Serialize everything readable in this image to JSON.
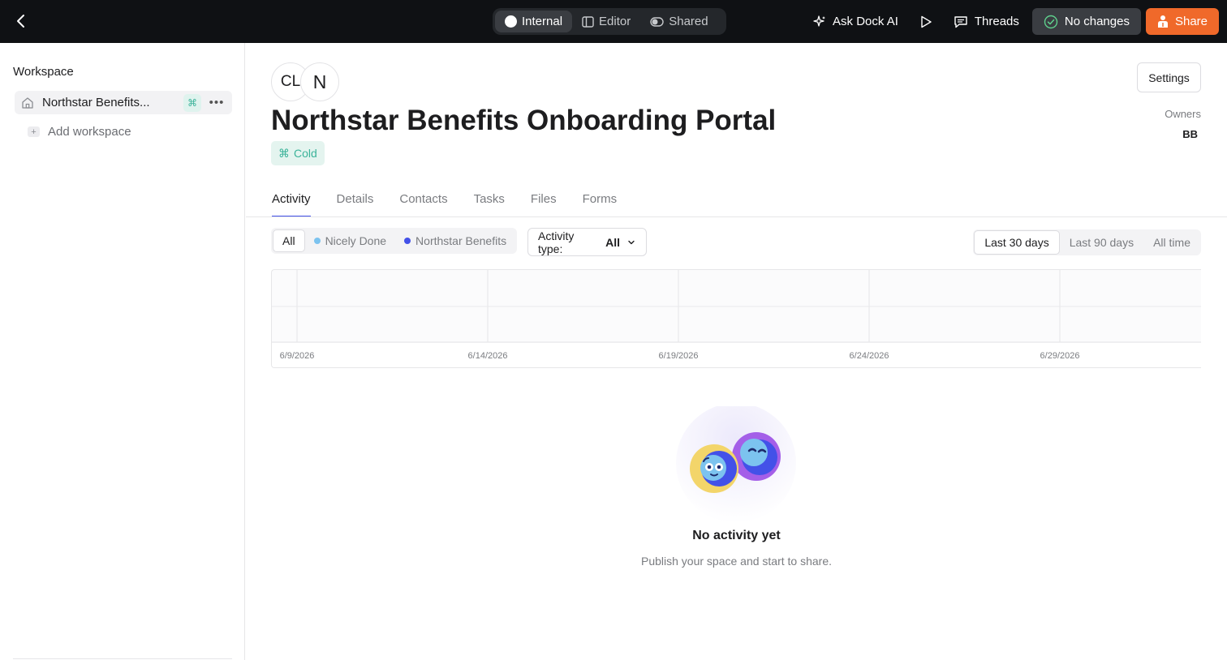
{
  "topbar": {
    "modes": [
      {
        "label": "Internal",
        "icon": "circle-icon",
        "active": true
      },
      {
        "label": "Editor",
        "icon": "sidebar-panel-icon",
        "active": false
      },
      {
        "label": "Shared",
        "icon": "toggle-icon",
        "active": false
      }
    ],
    "ask_ai_label": "Ask Dock AI",
    "threads_label": "Threads",
    "no_changes_label": "No changes",
    "share_label": "Share",
    "colors": {
      "bar_bg": "#0f1114",
      "share_bg": "#f0692a",
      "no_changes_bg": "#3a3d42"
    }
  },
  "sidebar": {
    "title": "Workspace",
    "items": [
      {
        "label": "Northstar Benefits...",
        "icon": "home-icon",
        "badge_icon": "command-icon"
      }
    ],
    "add_label": "Add workspace"
  },
  "header": {
    "avatars": [
      "CL",
      "N"
    ],
    "title": "Northstar Benefits Onboarding Portal",
    "status": "Cold",
    "settings_label": "Settings",
    "owners_label": "Owners",
    "owners_value": "BB"
  },
  "tabs": [
    "Activity",
    "Details",
    "Contacts",
    "Tasks",
    "Files",
    "Forms"
  ],
  "filters": {
    "parties": [
      {
        "label": "All",
        "active": true
      },
      {
        "label": "Nicely Done",
        "color": "#7cc3ef"
      },
      {
        "label": "Northstar Benefits",
        "color": "#4351e8"
      }
    ],
    "activity_type_label": "Activity type:",
    "activity_type_value": "All",
    "ranges": [
      {
        "label": "Last 30 days",
        "active": true
      },
      {
        "label": "Last 90 days",
        "active": false
      },
      {
        "label": "All time",
        "active": false
      }
    ]
  },
  "chart_data": {
    "type": "line",
    "title": "",
    "xlabel": "",
    "ylabel": "",
    "x_ticks": [
      "6/9/2026",
      "6/14/2026",
      "6/19/2026",
      "6/24/2026",
      "6/29/2026"
    ],
    "series": [],
    "grid": true
  },
  "empty_state": {
    "title": "No activity yet",
    "subtitle": "Publish your space and start to share."
  }
}
